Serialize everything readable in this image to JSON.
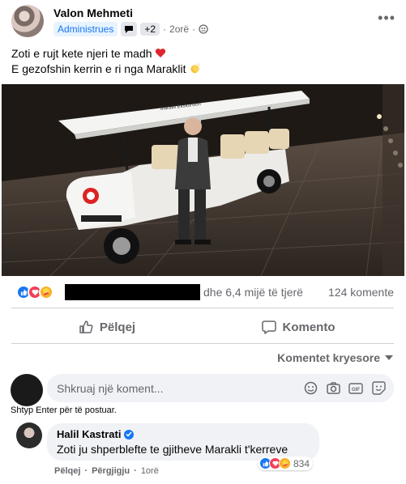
{
  "post": {
    "author": "Valon Mehmeti",
    "role_badge": "Administrues",
    "extra_badges": "+2",
    "separator": "·",
    "time": "2orë",
    "more_label": "•••",
    "text_line1": "Zoti e rujt kete njeri te madh",
    "text_line2": "E gezofshin kerrin e ri nga Maraklit"
  },
  "stats": {
    "others": "dhe 6,4 mijë të tjerë",
    "comments": "124 komente"
  },
  "actions": {
    "like": "Pëlqej",
    "comment": "Komento"
  },
  "sort": {
    "label": "Komentet kryesore"
  },
  "composer": {
    "placeholder": "Shkruaj një koment...",
    "hint": "Shtyp Enter për të postuar."
  },
  "comment": {
    "author": "Halil Kastrati",
    "text": "Zoti ju shperblefte te gjitheve Marakli t'kerreve",
    "reaction_count": "834",
    "like": "Pëlqej",
    "reply": "Përgjigju",
    "time": "1orë",
    "dot": "·"
  },
  "image": {
    "cart_sign": "Marakli Ekskursion"
  },
  "colors": {
    "fb_blue": "#1877f2",
    "love_red": "#f33e58",
    "haha_yellow": "#f7b125",
    "text_secondary": "#65676b"
  }
}
